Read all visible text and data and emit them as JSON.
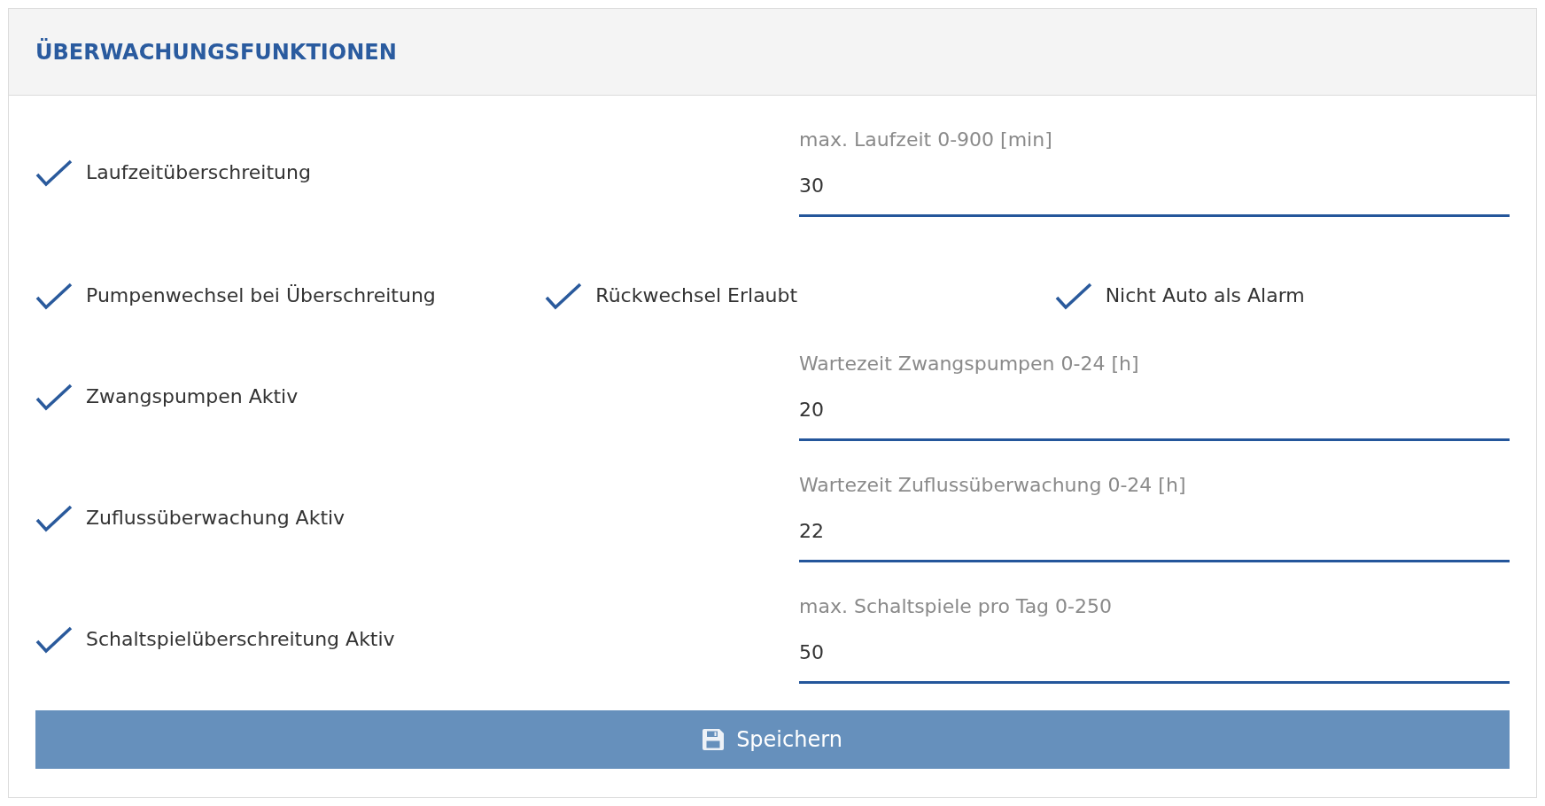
{
  "panel": {
    "title": "ÜBERWACHUNGSFUNKTIONEN"
  },
  "rows": [
    {
      "kind": "checkbox_field",
      "checkboxes": [
        {
          "label": "Laufzeitüberschreitung",
          "checked": true
        }
      ],
      "field": {
        "label": "max. Laufzeit 0-900 [min]",
        "value": "30"
      }
    },
    {
      "kind": "checkbox_group",
      "checkboxes": [
        {
          "label": "Pumpenwechsel bei Überschreitung",
          "checked": true
        },
        {
          "label": "Rückwechsel Erlaubt",
          "checked": true
        },
        {
          "label": "Nicht Auto als Alarm",
          "checked": true
        }
      ]
    },
    {
      "kind": "checkbox_field",
      "checkboxes": [
        {
          "label": "Zwangspumpen Aktiv",
          "checked": true
        }
      ],
      "field": {
        "label": "Wartezeit Zwangspumpen 0-24 [h]",
        "value": "20"
      }
    },
    {
      "kind": "checkbox_field",
      "checkboxes": [
        {
          "label": "Zuflussüberwachung Aktiv",
          "checked": true
        }
      ],
      "field": {
        "label": "Wartezeit Zuflussüberwachung 0-24 [h]",
        "value": "22"
      }
    },
    {
      "kind": "checkbox_field",
      "checkboxes": [
        {
          "label": "Schaltspielüberschreitung Aktiv",
          "checked": true
        }
      ],
      "field": {
        "label": "max. Schaltspiele pro Tag 0-250",
        "value": "50"
      }
    }
  ],
  "save_button": {
    "label": "Speichern"
  }
}
